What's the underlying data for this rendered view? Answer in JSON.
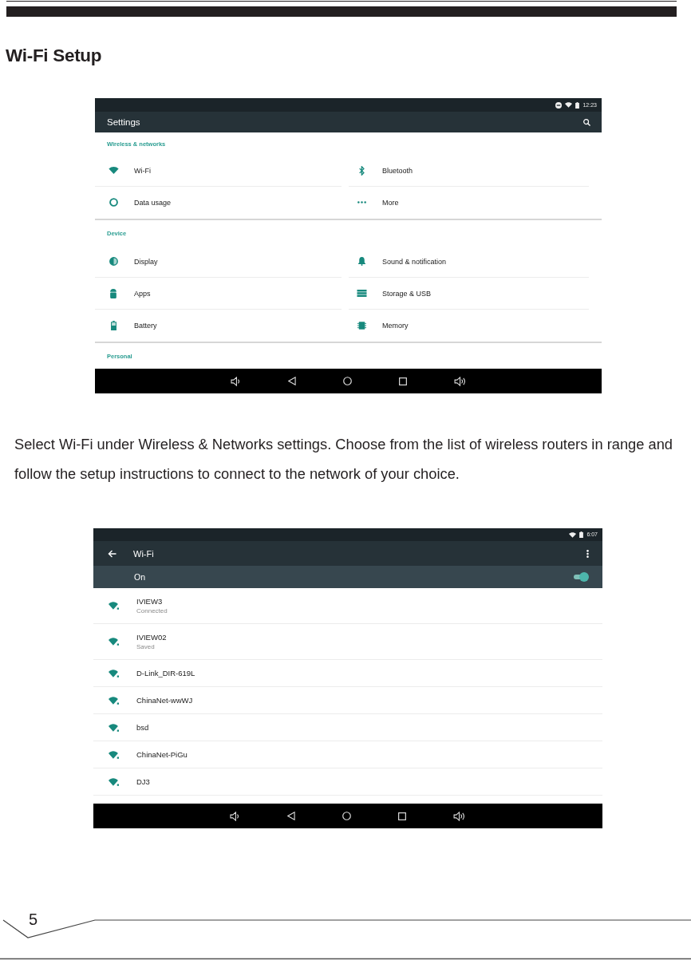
{
  "header": {
    "title": "Wi-Fi Setup"
  },
  "settings_screen": {
    "status_bar": {
      "time": "12:23"
    },
    "toolbar": {
      "title": "Settings"
    },
    "sections": [
      {
        "title": "Wireless & networks",
        "items": [
          {
            "label": "Wi-Fi"
          },
          {
            "label": "Bluetooth"
          },
          {
            "label": "Data usage"
          },
          {
            "label": "More"
          }
        ]
      },
      {
        "title": "Device",
        "items": [
          {
            "label": "Display"
          },
          {
            "label": "Sound & notification"
          },
          {
            "label": "Apps"
          },
          {
            "label": "Storage & USB"
          },
          {
            "label": "Battery"
          },
          {
            "label": "Memory"
          }
        ]
      },
      {
        "title": "Personal"
      }
    ]
  },
  "instructions": "Select Wi-Fi under Wireless & Networks settings. Choose from the list of wireless routers in range and follow the setup instructions to connect to the network of your choice.",
  "wifi_screen": {
    "status_bar": {
      "time": "6:07"
    },
    "toolbar": {
      "title": "Wi-Fi"
    },
    "switch_bar": {
      "label": "On",
      "on": true
    },
    "networks": [
      {
        "name": "IVIEW3",
        "status": "Connected"
      },
      {
        "name": "IVIEW02",
        "status": "Saved"
      },
      {
        "name": "D-Link_DIR-619L"
      },
      {
        "name": "ChinaNet-wwWJ"
      },
      {
        "name": "bsd"
      },
      {
        "name": "ChinaNet-PiGu"
      },
      {
        "name": "DJ3"
      }
    ]
  },
  "footer": {
    "page_number": "5"
  }
}
